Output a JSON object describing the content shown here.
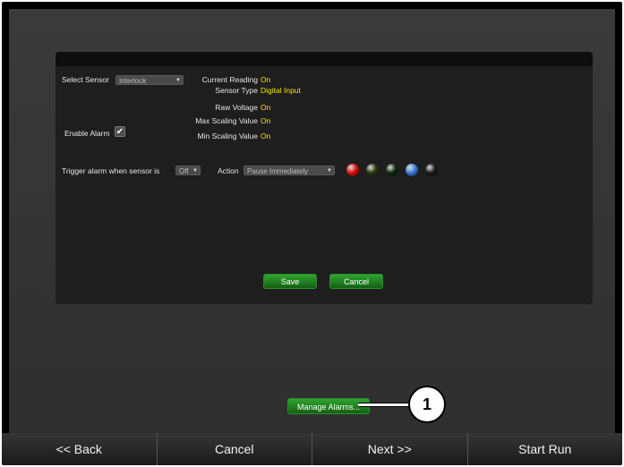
{
  "sensor": {
    "select_label": "Select Sensor",
    "select_value": "Interlock",
    "current_reading_label": "Current Reading",
    "current_reading_value": "On",
    "sensor_type_label": "Sensor Type",
    "sensor_type_value": "Digital Input",
    "raw_voltage_label": "Raw Voltage",
    "raw_voltage_value": "On",
    "max_scaling_label": "Max Scaling Value",
    "max_scaling_value": "On",
    "min_scaling_label": "Min Scaling Value",
    "min_scaling_value": "On"
  },
  "alarm": {
    "enable_label": "Enable Alarm",
    "enabled": true,
    "checkmark": "✔",
    "trigger_label": "Trigger alarm when sensor is",
    "trigger_value": "Off",
    "action_label": "Action",
    "action_value": "Pause Immediately",
    "indicator_colors": [
      "#e01010",
      "#2a3a10",
      "#0e2a0e",
      "#3a7de0",
      "#1c1c1c"
    ],
    "save_label": "Save",
    "cancel_label": "Cancel"
  },
  "manage_alarms_label": "Manage Alarms...",
  "callout_number": "1",
  "bottom_nav": {
    "back": "<< Back",
    "cancel": "Cancel",
    "next": "Next >>",
    "start_run": "Start Run"
  }
}
